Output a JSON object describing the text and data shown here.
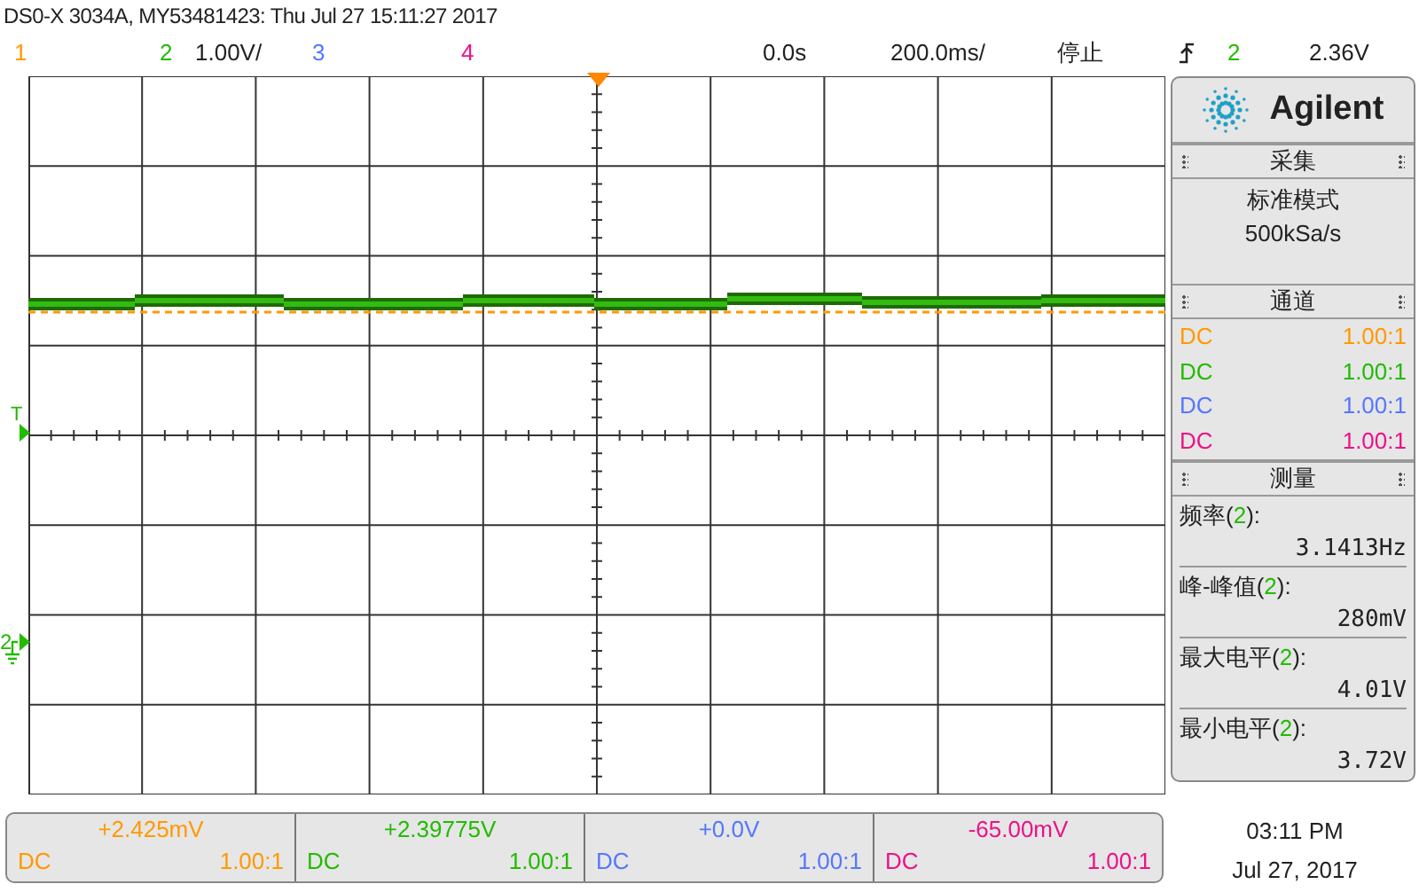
{
  "title": "DS0-X 3034A, MY53481423: Thu Jul 27 15:11:27 2017",
  "header": {
    "channels": [
      {
        "label": "1",
        "color": "#ff9900"
      },
      {
        "label": "2",
        "color": "#22bb00",
        "scale": "1.00V/"
      },
      {
        "label": "3",
        "color": "#5577ff"
      },
      {
        "label": "4",
        "color": "#ee1188"
      }
    ],
    "time_offset": "0.0s",
    "timebase": "200.0ms/",
    "run_state": "停止",
    "trigger": {
      "source": "2",
      "color": "#22bb00",
      "level": "2.36V"
    }
  },
  "screen": {
    "trigger_marker": {
      "text": "T",
      "color": "#22bb00"
    },
    "ground_marker": {
      "text": "2",
      "color": "#22bb00"
    }
  },
  "panel": {
    "brand": "Agilent",
    "acquisition": {
      "title": "采集",
      "mode": "标准模式",
      "rate": "500kSa/s"
    },
    "channels": {
      "title": "通道",
      "rows": [
        {
          "coupling": "DC",
          "probe": "1.00:1",
          "color": "#ff9900"
        },
        {
          "coupling": "DC",
          "probe": "1.00:1",
          "color": "#22bb00"
        },
        {
          "coupling": "DC",
          "probe": "1.00:1",
          "color": "#5577ff"
        },
        {
          "coupling": "DC",
          "probe": "1.00:1",
          "color": "#ee1188"
        }
      ]
    },
    "measurements": {
      "title": "测量",
      "items": [
        {
          "label": "频率(",
          "source": "2",
          "suffix": "):",
          "color": "#22bb00",
          "value": "3.1413Hz"
        },
        {
          "label": "峰-峰值(",
          "source": "2",
          "suffix": "):",
          "color": "#22bb00",
          "value": "280mV"
        },
        {
          "label": "最大电平(",
          "source": "2",
          "suffix": "):",
          "color": "#22bb00",
          "value": "4.01V"
        },
        {
          "label": "最小电平(",
          "source": "2",
          "suffix": "):",
          "color": "#22bb00",
          "value": "3.72V"
        }
      ]
    }
  },
  "footer": {
    "channels": [
      {
        "offset": "+2.425mV",
        "coupling": "DC",
        "probe": "1.00:1",
        "color": "#ff9900"
      },
      {
        "offset": "+2.39775V",
        "coupling": "DC",
        "probe": "1.00:1",
        "color": "#22bb00"
      },
      {
        "offset": "+0.0V",
        "coupling": "DC",
        "probe": "1.00:1",
        "color": "#5577ff"
      },
      {
        "offset": "-65.00mV",
        "coupling": "DC",
        "probe": "1.00:1",
        "color": "#ee1188"
      }
    ],
    "time": "03:11 PM",
    "date": "Jul 27, 2017"
  }
}
